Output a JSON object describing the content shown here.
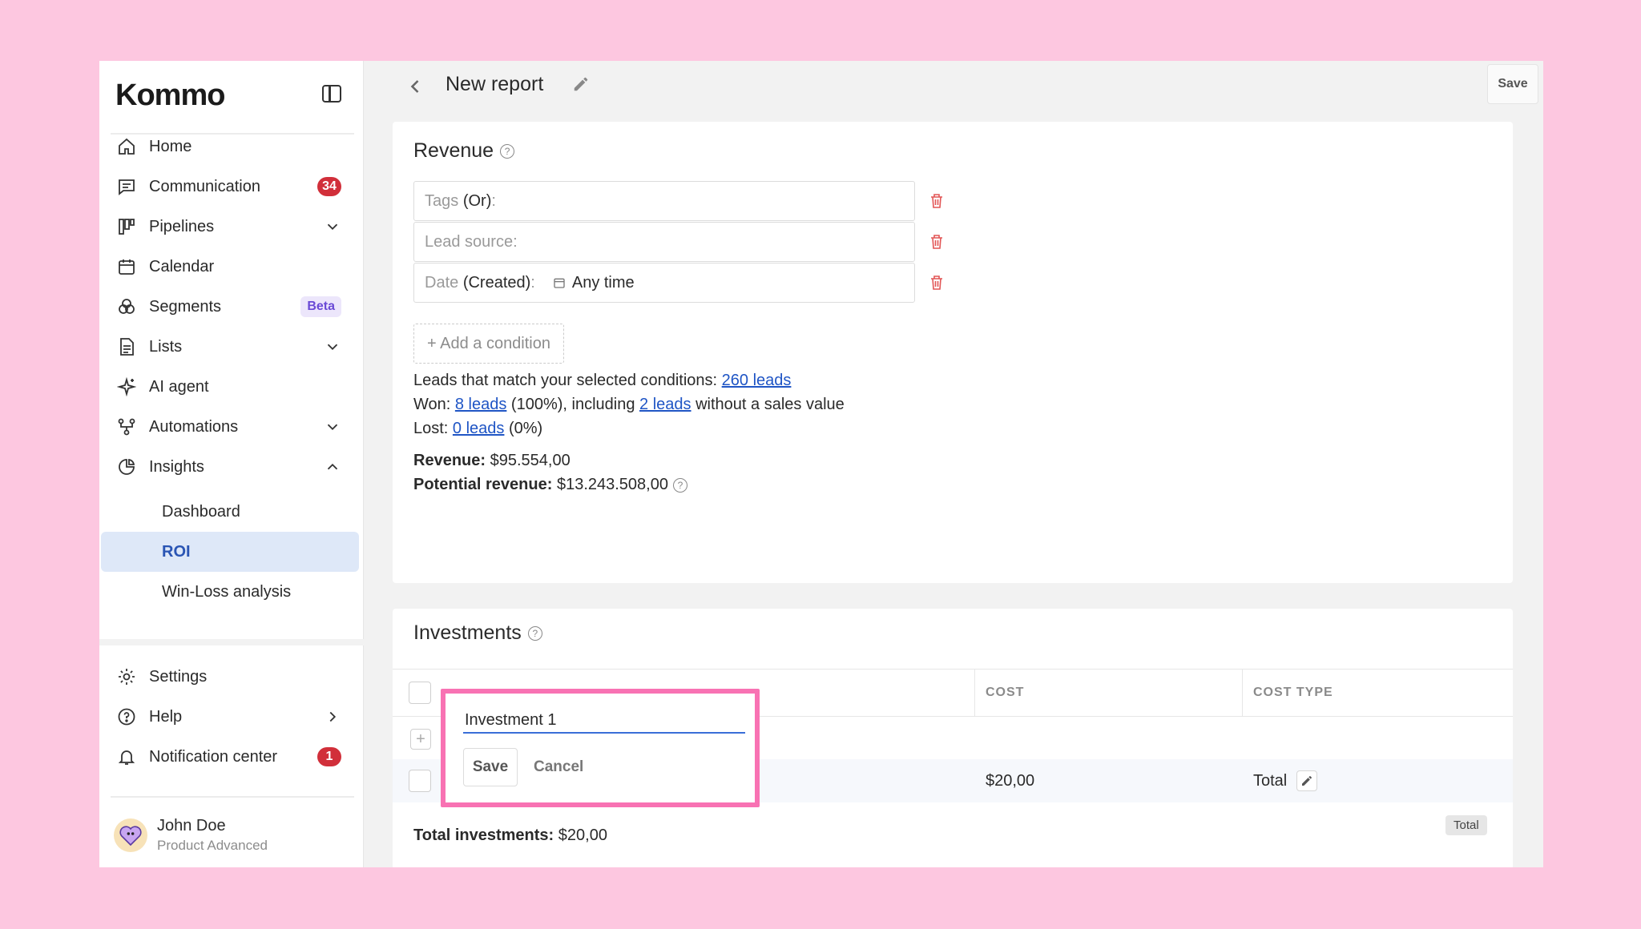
{
  "sidebar": {
    "logo": "Kommo",
    "nav": [
      {
        "label": "Home",
        "icon": "home-icon"
      },
      {
        "label": "Communication",
        "icon": "chat-icon",
        "badge": "34"
      },
      {
        "label": "Pipelines",
        "icon": "pipelines-icon",
        "expand": "down"
      },
      {
        "label": "Calendar",
        "icon": "calendar-icon"
      },
      {
        "label": "Segments",
        "icon": "segments-icon",
        "tag": "Beta"
      },
      {
        "label": "Lists",
        "icon": "lists-icon",
        "expand": "down"
      },
      {
        "label": "AI agent",
        "icon": "sparkle-icon"
      },
      {
        "label": "Automations",
        "icon": "automations-icon",
        "expand": "down"
      },
      {
        "label": "Insights",
        "icon": "insights-icon",
        "expand": "up"
      }
    ],
    "insights_sub": [
      {
        "label": "Dashboard"
      },
      {
        "label": "ROI",
        "active": true
      },
      {
        "label": "Win-Loss analysis"
      }
    ],
    "bottom": [
      {
        "label": "Settings",
        "icon": "gear-icon"
      },
      {
        "label": "Help",
        "icon": "help-icon",
        "expand": "right"
      },
      {
        "label": "Notification center",
        "icon": "bell-icon",
        "badge": "1"
      }
    ],
    "user": {
      "name": "John Doe",
      "plan": "Product Advanced"
    }
  },
  "header": {
    "title": "New report",
    "save_label": "Save"
  },
  "revenue": {
    "title": "Revenue",
    "conditions": [
      {
        "muted": "Tags ",
        "dark": "(Or)",
        "tail": ":"
      },
      {
        "muted": "Lead source:"
      },
      {
        "muted": "Date ",
        "dark": "(Created)",
        "tail": ":",
        "value": "Any time"
      }
    ],
    "add_condition": "+ Add a condition",
    "match_prefix": "Leads that match your selected conditions: ",
    "match_link": "260 leads",
    "won_prefix": "Won: ",
    "won_link": "8 leads",
    "won_mid": " (100%), including ",
    "won_link2": "2 leads",
    "won_suffix": " without a sales value",
    "lost_prefix": "Lost: ",
    "lost_link": "0 leads",
    "lost_suffix": " (0%)",
    "revenue_label": "Revenue:",
    "revenue_value": " $95.554,00",
    "potential_label": "Potential revenue:",
    "potential_value": " $13.243.508,00"
  },
  "investments": {
    "title": "Investments",
    "columns": [
      "COST",
      "COST TYPE"
    ],
    "row": {
      "cost": "$20,00",
      "cost_type": "Total"
    },
    "total_tag": "Total",
    "total_label": "Total investments:",
    "total_value": " $20,00"
  },
  "editor": {
    "value": "Investment 1",
    "save_label": "Save",
    "cancel_label": "Cancel"
  },
  "colors": {
    "accent": "#1f55c5",
    "badge": "#d12f3a",
    "highlight": "#f872b3",
    "active_bg": "#dee8f8"
  }
}
